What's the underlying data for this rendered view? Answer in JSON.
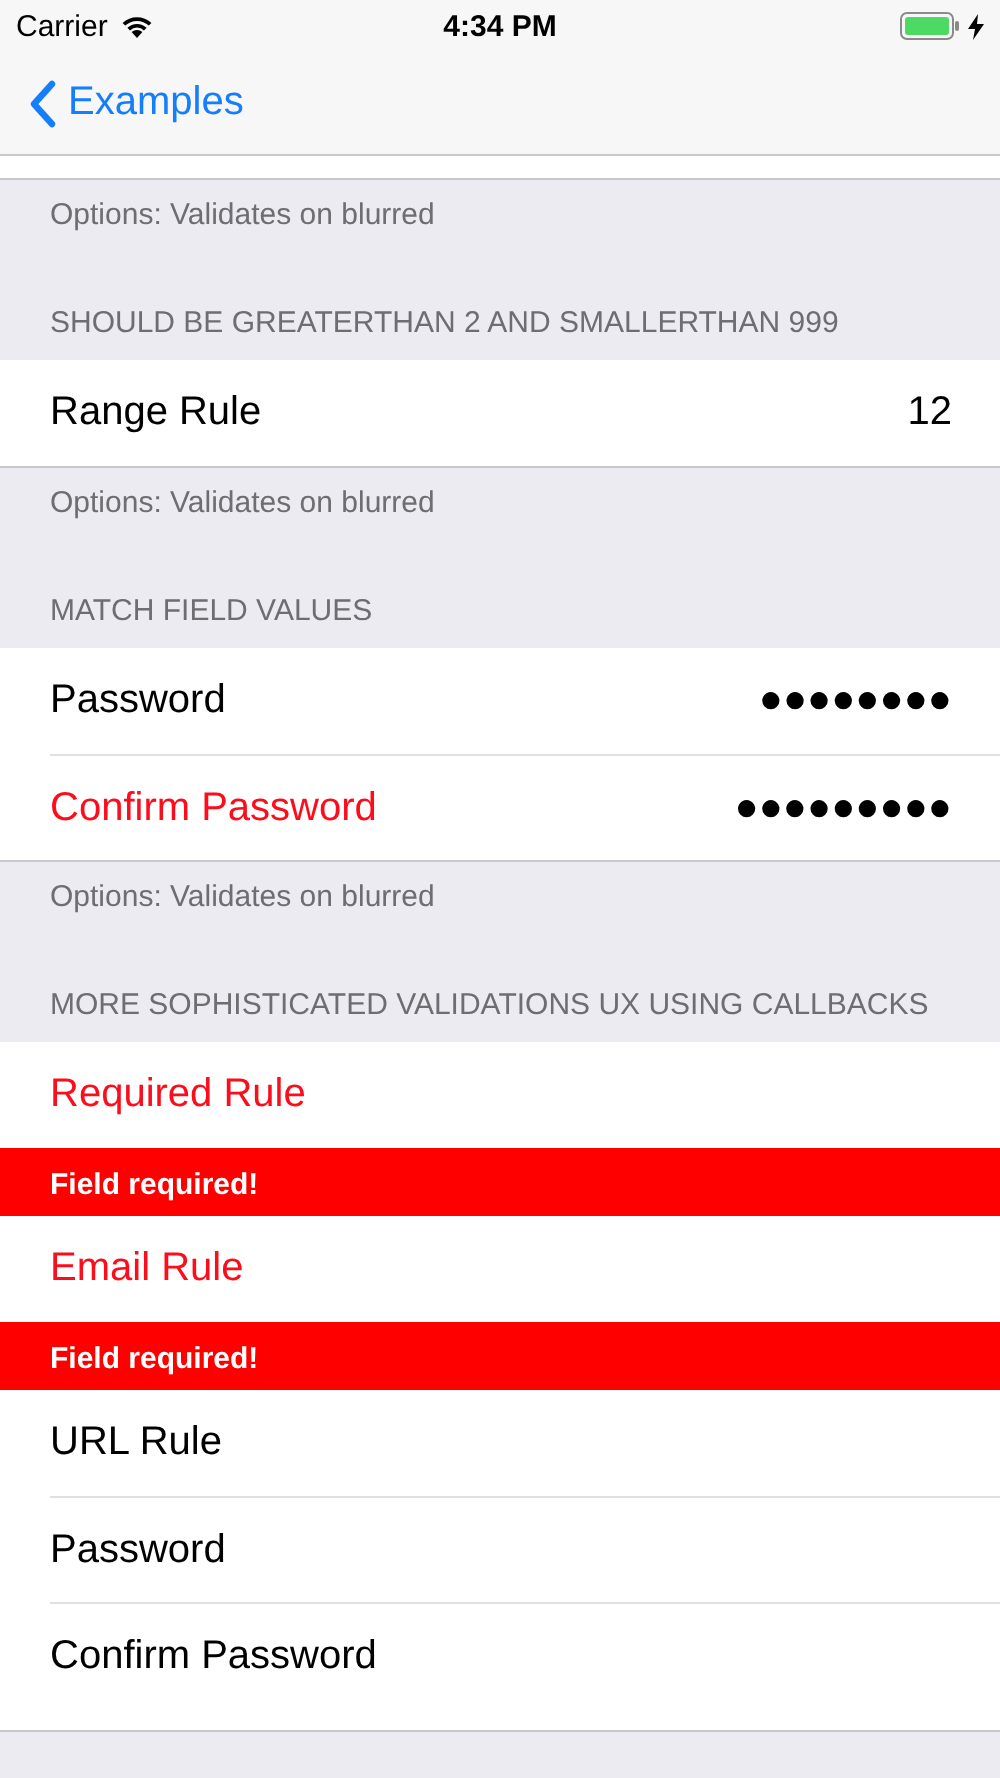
{
  "status_bar": {
    "carrier": "Carrier",
    "time": "4:34 PM"
  },
  "nav_bar": {
    "back_label": "Examples"
  },
  "sections": [
    {
      "footer": "Options: Validates on blurred",
      "rows": [
        {
          "kind": "blank"
        }
      ]
    },
    {
      "header": "SHOULD BE GREATERTHAN 2 AND SMALLERTHAN 999",
      "rows": [
        {
          "kind": "field",
          "label": "Range Rule",
          "value": "12",
          "invalid": false
        }
      ],
      "footer": "Options: Validates on blurred"
    },
    {
      "header": "MATCH FIELD VALUES",
      "rows": [
        {
          "kind": "field",
          "label": "Password",
          "value": "●●●●●●●●",
          "invalid": false
        },
        {
          "kind": "field",
          "label": "Confirm Password",
          "value": "●●●●●●●●●",
          "invalid": true
        }
      ],
      "footer": "Options: Validates on blurred"
    },
    {
      "header": "MORE SOPHISTICATED VALIDATIONS UX USING CALLBACKS",
      "rows": [
        {
          "kind": "field",
          "label": "Required Rule",
          "invalid": true
        },
        {
          "kind": "error",
          "message": "Field required!"
        },
        {
          "kind": "field",
          "label": "Email Rule",
          "invalid": true
        },
        {
          "kind": "error",
          "message": "Field required!"
        },
        {
          "kind": "field",
          "label": "URL Rule",
          "invalid": false
        },
        {
          "kind": "field",
          "label": "Password",
          "invalid": false
        },
        {
          "kind": "field",
          "label": "Confirm Password",
          "invalid": false
        },
        {
          "kind": "blank"
        }
      ]
    }
  ]
}
